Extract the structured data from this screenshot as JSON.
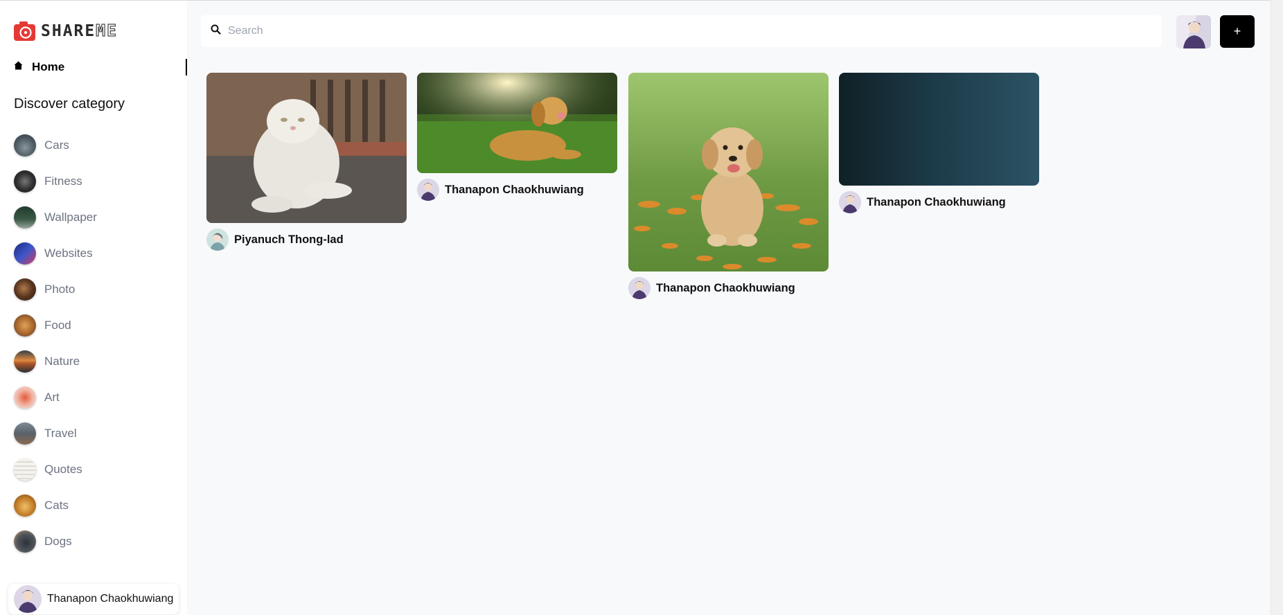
{
  "app": {
    "logo_main": "SHARE",
    "logo_accent": "ME"
  },
  "sidebar": {
    "home_label": "Home",
    "section_title": "Discover category",
    "categories": [
      {
        "label": "Cars",
        "thumb_color": "#5b6b73"
      },
      {
        "label": "Fitness",
        "thumb_color": "#3a3a3a"
      },
      {
        "label": "Wallpaper",
        "thumb_color": "#2e4a3a"
      },
      {
        "label": "Websites",
        "thumb_color": "#2c3e8c"
      },
      {
        "label": "Photo",
        "thumb_color": "#5a3a26"
      },
      {
        "label": "Food",
        "thumb_color": "#b0763a"
      },
      {
        "label": "Nature",
        "thumb_color": "#d07a3a"
      },
      {
        "label": "Art",
        "thumb_color": "#d9553a"
      },
      {
        "label": "Travel",
        "thumb_color": "#6f7c86"
      },
      {
        "label": "Quotes",
        "thumb_color": "#ecebe4"
      },
      {
        "label": "Cats",
        "thumb_color": "#c8872e"
      },
      {
        "label": "Dogs",
        "thumb_color": "#4a4e55"
      }
    ],
    "user_name": "Thanapon Chaokhuwiang"
  },
  "header": {
    "search_placeholder": "Search",
    "add_label": "+"
  },
  "pins": [
    {
      "author": "Piyanuch Thong-lad",
      "image": "white persian cat"
    },
    {
      "author": "Thanapon Chaokhuwiang",
      "image": "golden retriever on grass"
    },
    {
      "author": "Thanapon Chaokhuwiang",
      "image": "golden retriever puppy"
    },
    {
      "author": "Thanapon Chaokhuwiang",
      "image": "dark teal gradient"
    }
  ],
  "colors": {
    "brand": "#e53935",
    "button": "#000000",
    "background": "#f8f9fb"
  }
}
